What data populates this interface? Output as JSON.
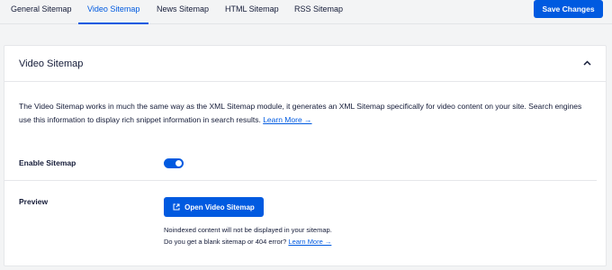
{
  "tabs": [
    {
      "label": "General Sitemap",
      "active": false
    },
    {
      "label": "Video Sitemap",
      "active": true
    },
    {
      "label": "News Sitemap",
      "active": false
    },
    {
      "label": "HTML Sitemap",
      "active": false
    },
    {
      "label": "RSS Sitemap",
      "active": false
    }
  ],
  "toolbar": {
    "save_label": "Save Changes"
  },
  "card": {
    "title": "Video Sitemap",
    "description": "The Video Sitemap works in much the same way as the XML Sitemap module, it generates an XML Sitemap specifically for video content on your site. Search engines use this information to display rich snippet information in search results.",
    "description_link": "Learn More →",
    "enable_label": "Enable Sitemap",
    "enable_value": true,
    "preview_label": "Preview",
    "open_button_label": "Open Video Sitemap",
    "note_line1": "Noindexed content will not be displayed in your sitemap.",
    "note_line2": "Do you get a blank sitemap or 404 error?",
    "note_link": "Learn More →"
  },
  "colors": {
    "accent": "#005ae0",
    "background": "#f3f4f5",
    "text": "#141b38"
  },
  "icons": {
    "collapse": "chevron-up-icon",
    "open": "external-link-icon"
  }
}
